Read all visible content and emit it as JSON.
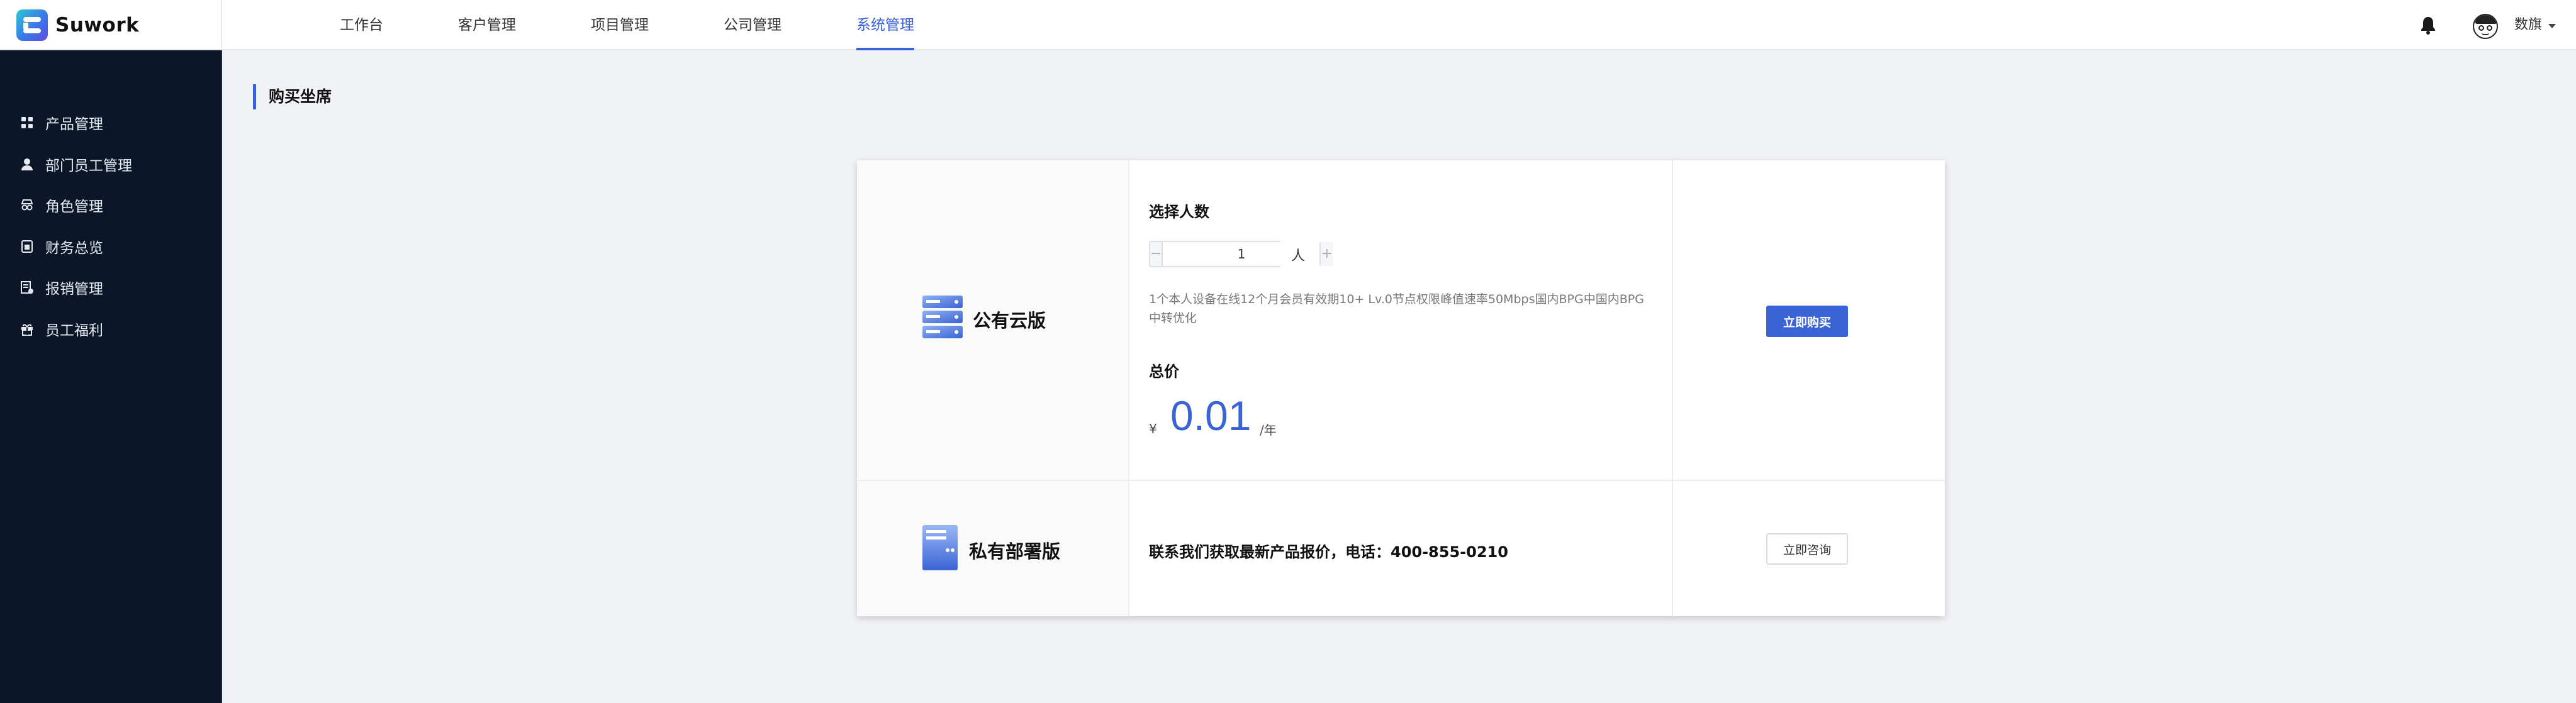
{
  "app": {
    "name": "Suwork"
  },
  "nav": {
    "items": [
      {
        "label": "工作台",
        "active": false
      },
      {
        "label": "客户管理",
        "active": false
      },
      {
        "label": "项目管理",
        "active": false
      },
      {
        "label": "公司管理",
        "active": false
      },
      {
        "label": "系统管理",
        "active": true
      }
    ]
  },
  "user": {
    "name": "数旗"
  },
  "sidebar": {
    "items": [
      {
        "label": "产品管理",
        "icon": "grid-icon"
      },
      {
        "label": "部门员工管理",
        "icon": "user-icon"
      },
      {
        "label": "角色管理",
        "icon": "role-icon"
      },
      {
        "label": "财务总览",
        "icon": "finance-icon"
      },
      {
        "label": "报销管理",
        "icon": "receipt-icon"
      },
      {
        "label": "员工福利",
        "icon": "gift-icon"
      }
    ]
  },
  "page": {
    "title": "购买坐席"
  },
  "plans": {
    "public": {
      "name": "公有云版",
      "select_label": "选择人数",
      "quantity": "1",
      "minus": "−",
      "plus": "+",
      "unit": "人",
      "description": "1个本人设备在线12个月会员有效期10+ Lv.0节点权限峰值速率50Mbps国内BPG中国内BPG中转优化",
      "total_label": "总价",
      "currency": "¥",
      "price": "0.01",
      "period": "/年",
      "button": "立即购买"
    },
    "private": {
      "name": "私有部署版",
      "contact": "联系我们获取最新产品报价，电话：400-855-0210",
      "button": "立即咨询"
    }
  },
  "colors": {
    "accent": "#3a63d6",
    "sidebar_bg": "#0b1628"
  }
}
